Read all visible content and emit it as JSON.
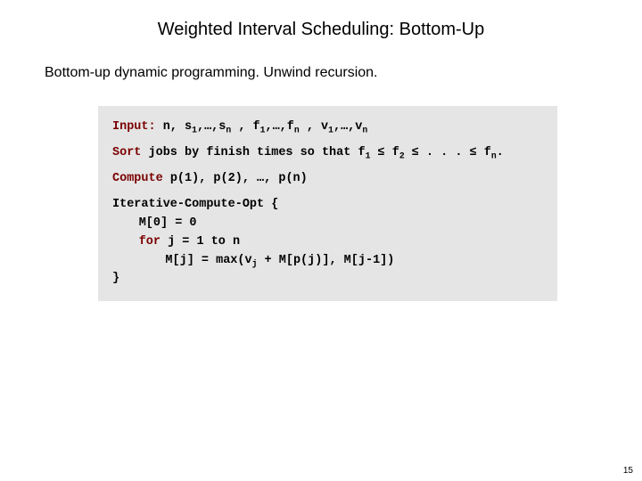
{
  "title": "Weighted Interval Scheduling:  Bottom-Up",
  "subtitle": {
    "lead": "Bottom-up dynamic programming.",
    "rest": "  Unwind recursion."
  },
  "code": {
    "input_kw": "Input:",
    "input_rest_a": " n, s",
    "input_rest_b": ",…,s",
    "input_rest_c": " , f",
    "input_rest_d": ",…,f",
    "input_rest_e": " , v",
    "input_rest_f": ",…,v",
    "sub_1": "1",
    "sub_n": "n",
    "sub_2": "2",
    "sort_kw": "Sort",
    "sort_rest_a": " jobs by finish times so that f",
    "sort_rest_b": " ≤ f",
    "sort_rest_c": " ≤ . . . ≤ f",
    "sort_rest_d": ".",
    "compute_kw": "Compute",
    "compute_rest": " p(1), p(2), …, p(n)",
    "fn_header": "Iterative-Compute-Opt {",
    "fn_line1": "M[0] = 0",
    "fn_for_kw": "for",
    "fn_for_rest": " j = 1 to n",
    "fn_body_a": "M[j] = max(v",
    "fn_body_b": " + M[p(j)], M[j-1])",
    "sub_j": "j",
    "fn_close": "}"
  },
  "pagenum": "15"
}
